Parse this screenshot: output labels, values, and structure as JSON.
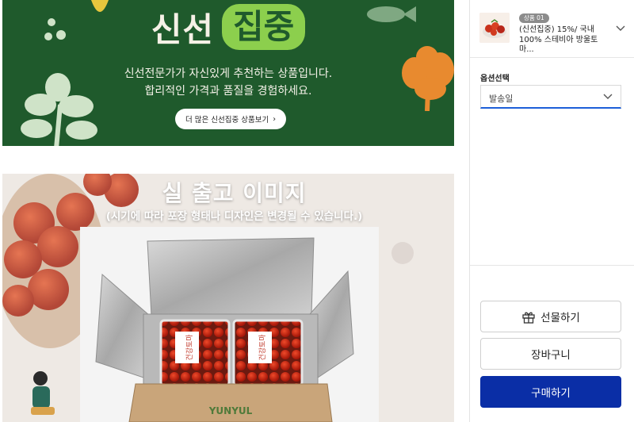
{
  "banner": {
    "title_part1": "신선",
    "title_part2": "집중",
    "desc_line1": "신선전문가가 자신있게 추천하는 상품입니다.",
    "desc_line2": "합리적인 가격과 품질을 경험하세요.",
    "more_button_label": "더 많은 신선집중 상품보기",
    "more_button_arrow": "›"
  },
  "photo_section": {
    "title": "실 출고 이미지",
    "caption": "(시기에 따라 포장 형태나 디자인은 변경될 수 있습니다.)",
    "box_brand_text": "YUNYUL",
    "pack_label_text": "건강토마"
  },
  "panel": {
    "product": {
      "badge": "상품 01",
      "name": "(신선집중) 15%/ 국내100% 스테비아 방울토마..."
    },
    "option_label": "옵션선택",
    "select_value": "발송일",
    "gift_button_label": "선물하기",
    "cart_button_label": "장바구니",
    "buy_button_label": "구매하기"
  },
  "colors": {
    "banner_green": "#1f5a2c",
    "accent_lime": "#8ccf4d",
    "buy_blue": "#0a2ea6",
    "select_underline": "#1d5fd8"
  },
  "icons": [
    "chevron-right-icon",
    "chevron-down-icon",
    "gift-icon"
  ]
}
